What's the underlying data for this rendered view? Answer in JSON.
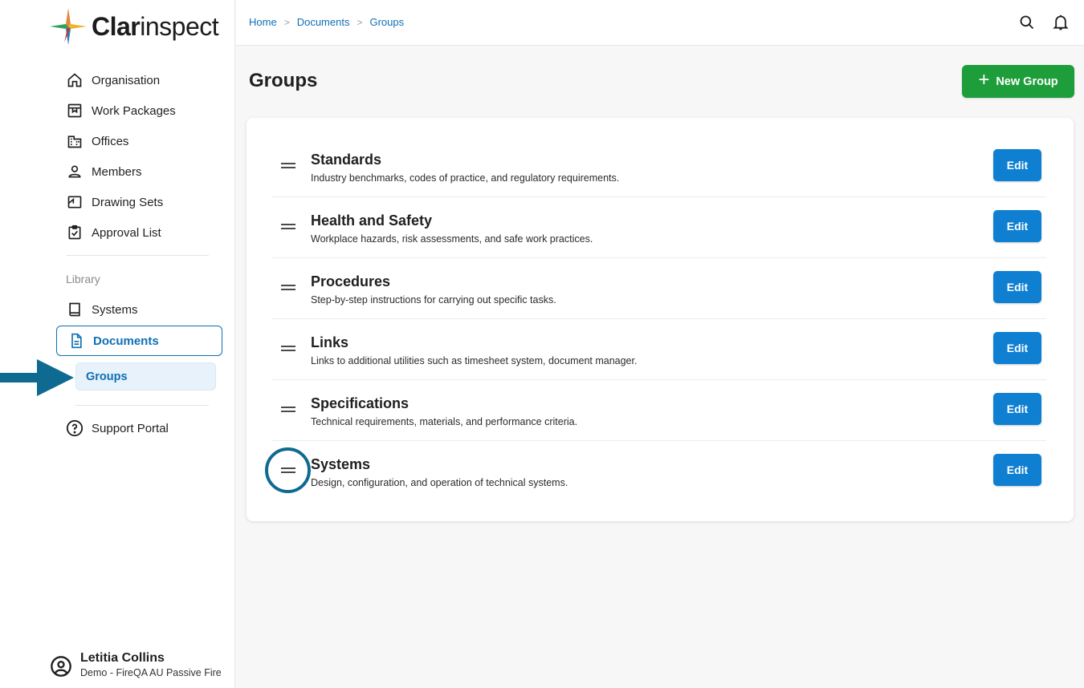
{
  "app": {
    "logo_bold": "Clar",
    "logo_rest": "inspect"
  },
  "sidebar": {
    "items": [
      {
        "label": "Organisation",
        "icon": "home-icon"
      },
      {
        "label": "Work Packages",
        "icon": "package-icon"
      },
      {
        "label": "Offices",
        "icon": "building-icon"
      },
      {
        "label": "Members",
        "icon": "person-icon"
      },
      {
        "label": "Drawing Sets",
        "icon": "drawing-icon"
      },
      {
        "label": "Approval List",
        "icon": "clipboard-check-icon"
      }
    ],
    "library_label": "Library",
    "library_items": [
      {
        "label": "Systems",
        "icon": "book-icon"
      }
    ],
    "documents_label": "Documents",
    "groups_label": "Groups",
    "support_label": "Support Portal"
  },
  "user": {
    "name": "Letitia Collins",
    "org": "Demo - FireQA AU Passive Fire"
  },
  "breadcrumb": [
    "Home",
    "Documents",
    "Groups"
  ],
  "page": {
    "title": "Groups",
    "new_button": "New Group"
  },
  "groups": [
    {
      "title": "Standards",
      "description": "Industry benchmarks, codes of practice, and regulatory requirements.",
      "edit": "Edit"
    },
    {
      "title": "Health and Safety",
      "description": "Workplace hazards, risk assessments, and safe work practices.",
      "edit": "Edit"
    },
    {
      "title": "Procedures",
      "description": "Step-by-step instructions for carrying out specific tasks.",
      "edit": "Edit"
    },
    {
      "title": "Links",
      "description": "Links to additional utilities such as timesheet system, document manager.",
      "edit": "Edit"
    },
    {
      "title": "Specifications",
      "description": "Technical requirements, materials, and performance criteria.",
      "edit": "Edit"
    },
    {
      "title": "Systems",
      "description": "Design, configuration, and operation of technical systems.",
      "edit": "Edit"
    }
  ],
  "colors": {
    "accent": "#0e6fb5",
    "primary_button": "#0e7fd1",
    "success_button": "#1e9e3a",
    "annotation": "#0f6a92"
  }
}
